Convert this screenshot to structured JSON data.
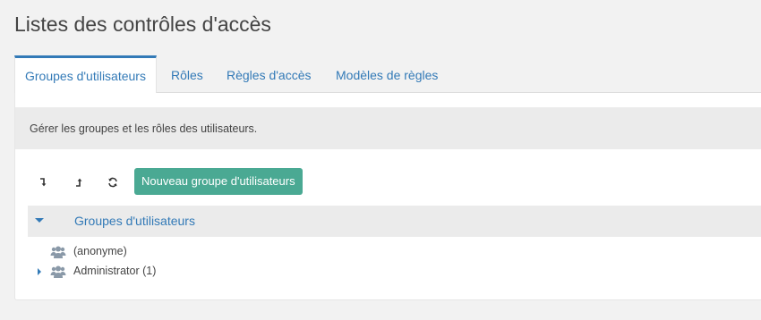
{
  "page": {
    "title": "Listes des contrôles d'accès"
  },
  "tabs": [
    {
      "label": "Groupes d'utilisateurs",
      "active": true
    },
    {
      "label": "Rôles",
      "active": false
    },
    {
      "label": "Règles d'accès",
      "active": false
    },
    {
      "label": "Modèles de règles",
      "active": false
    }
  ],
  "panel": {
    "description": "Gérer les groupes et les rôles des utilisateurs."
  },
  "toolbar": {
    "collapse_icon": "arrow-down-turn-icon",
    "expand_icon": "arrow-up-turn-icon",
    "refresh_icon": "refresh-icon",
    "new_group_label": "Nouveau groupe d'utilisateurs",
    "new_group_color": "#4aa993"
  },
  "tree": {
    "header_label": "Groupes d'utilisateurs",
    "items": [
      {
        "label": "(anonyme)",
        "icon": "users-icon",
        "has_children": false
      },
      {
        "label": "Administrator (1)",
        "icon": "users-icon",
        "has_children": true
      }
    ]
  },
  "colors": {
    "accent": "#337ab7",
    "icon_gray": "#8a99a8"
  }
}
